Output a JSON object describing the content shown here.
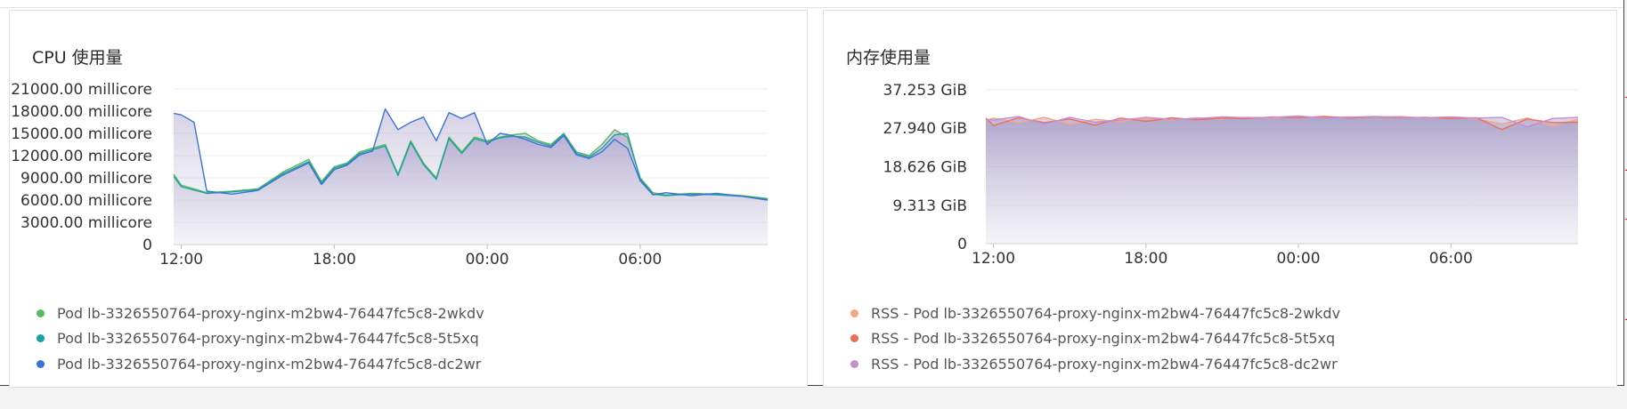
{
  "panels": {
    "cpu": {
      "title": "CPU 使用量"
    },
    "memory": {
      "title": "内存使用量"
    }
  },
  "chart_data": [
    {
      "type": "area",
      "title": "CPU 使用量",
      "ylabel": "",
      "xlabel": "",
      "y_unit": "millicore",
      "ylim": [
        0,
        21000
      ],
      "y_ticks": [
        0,
        3000,
        6000,
        9000,
        12000,
        15000,
        18000,
        21000
      ],
      "y_tick_labels": [
        "0",
        "3000.00 millicore",
        "6000.00 millicore",
        "9000.00 millicore",
        "12000.00 millicore",
        "15000.00 millicore",
        "18000.00 millicore",
        "21000.00 millicore"
      ],
      "x_unit": "hours since 12:00",
      "xlim": [
        -0.3,
        23.0
      ],
      "x_ticks": [
        0,
        6,
        12,
        18
      ],
      "x_tick_labels": [
        "12:00",
        "18:00",
        "00:00",
        "06:00"
      ],
      "grid": true,
      "legend_position": "bottom-left",
      "series": [
        {
          "name": "Pod lb-3326550764-proxy-nginx-m2bw4-76447fc5c8-2wkdv",
          "color": "#5cb85c",
          "x": [
            -0.3,
            0,
            1,
            2,
            3,
            4,
            5,
            5.5,
            6,
            6.5,
            7,
            7.5,
            8,
            8.5,
            9,
            9.5,
            10,
            10.5,
            11,
            11.5,
            12,
            12.5,
            13,
            13.5,
            14,
            14.5,
            15,
            15.5,
            16,
            16.5,
            17,
            17.5,
            18,
            18.5,
            19,
            20,
            21,
            22,
            23
          ],
          "y": [
            9500,
            8000,
            7000,
            7200,
            7500,
            9800,
            11500,
            8500,
            10500,
            11000,
            12500,
            13000,
            13500,
            9500,
            14000,
            11000,
            9000,
            14500,
            12500,
            14500,
            14000,
            14500,
            14800,
            15000,
            14000,
            13500,
            15000,
            12500,
            12000,
            13500,
            15500,
            14500,
            9000,
            7000,
            6700,
            6900,
            6800,
            6600,
            6200
          ]
        },
        {
          "name": "Pod lb-3326550764-proxy-nginx-m2bw4-76447fc5c8-5t5xq",
          "color": "#1aa3a3",
          "x": [
            -0.3,
            0,
            1,
            2,
            3,
            4,
            5,
            5.5,
            6,
            6.5,
            7,
            7.5,
            8,
            8.5,
            9,
            9.5,
            10,
            10.5,
            11,
            11.5,
            12,
            12.5,
            13,
            13.5,
            14,
            14.5,
            15,
            15.5,
            16,
            16.5,
            17,
            17.5,
            18,
            18.5,
            19,
            20,
            21,
            22,
            23
          ],
          "y": [
            9200,
            7800,
            6900,
            7100,
            7400,
            9600,
            11200,
            8300,
            10300,
            10900,
            12300,
            12800,
            13300,
            9300,
            13800,
            10800,
            8800,
            14300,
            12300,
            14300,
            13800,
            14400,
            14600,
            14500,
            13800,
            13300,
            14900,
            12300,
            11800,
            13000,
            14800,
            15000,
            8800,
            6800,
            6600,
            6800,
            6700,
            6500,
            6100
          ]
        },
        {
          "name": "Pod lb-3326550764-proxy-nginx-m2bw4-76447fc5c8-dc2wr",
          "color": "#3b73d6",
          "x": [
            -0.3,
            0,
            0.5,
            1,
            2,
            3,
            4,
            5,
            5.5,
            6,
            6.5,
            7,
            7.5,
            8,
            8.5,
            9,
            9.5,
            10,
            10.5,
            11,
            11.5,
            12,
            12.5,
            13,
            13.5,
            14,
            14.5,
            15,
            15.5,
            16,
            16.5,
            17,
            17.5,
            18,
            18.5,
            19,
            20,
            21,
            22,
            23
          ],
          "y": [
            17700,
            17500,
            16500,
            7200,
            6800,
            7300,
            9400,
            11000,
            8100,
            10100,
            10700,
            12100,
            12600,
            18300,
            15500,
            16500,
            17200,
            14000,
            17800,
            17000,
            17800,
            13500,
            15000,
            14700,
            14200,
            13500,
            13100,
            14700,
            12100,
            11600,
            12500,
            14200,
            13000,
            8600,
            6700,
            7000,
            6600,
            6900,
            6500,
            6000
          ]
        }
      ]
    },
    {
      "type": "area",
      "title": "内存使用量",
      "ylabel": "",
      "xlabel": "",
      "y_unit": "GiB",
      "ylim": [
        0,
        37.253
      ],
      "y_ticks": [
        0,
        9.313,
        18.626,
        27.94,
        37.253
      ],
      "y_tick_labels": [
        "0",
        "9.313 GiB",
        "18.626 GiB",
        "27.940 GiB",
        "37.253 GiB"
      ],
      "x_unit": "hours since 12:00",
      "xlim": [
        -0.3,
        23.0
      ],
      "x_ticks": [
        0,
        6,
        12,
        18
      ],
      "x_tick_labels": [
        "12:00",
        "18:00",
        "00:00",
        "06:00"
      ],
      "grid": true,
      "legend_position": "bottom-left",
      "series": [
        {
          "name": "RSS - Pod lb-3326550764-proxy-nginx-m2bw4-76447fc5c8-2wkdv",
          "color": "#f4a582",
          "x": [
            -0.3,
            0,
            1,
            2,
            3,
            4,
            5,
            6,
            7,
            8,
            9,
            10,
            11,
            12,
            13,
            14,
            15,
            16,
            17,
            18,
            19,
            20,
            21,
            22,
            23
          ],
          "y": [
            29.8,
            30.4,
            29.2,
            30.6,
            28.9,
            30.1,
            29.5,
            30.3,
            29.9,
            30.5,
            30.2,
            30.6,
            30.4,
            30.8,
            30.5,
            30.7,
            30.6,
            30.8,
            30.4,
            30.6,
            30.2,
            29.0,
            30.4,
            28.5,
            30.1
          ]
        },
        {
          "name": "RSS - Pod lb-3326550764-proxy-nginx-m2bw4-76447fc5c8-5t5xq",
          "color": "#e8705a",
          "x": [
            -0.3,
            0,
            1,
            2,
            3,
            4,
            5,
            6,
            7,
            8,
            9,
            10,
            11,
            12,
            13,
            14,
            15,
            16,
            17,
            18,
            19,
            20,
            21,
            22,
            23
          ],
          "y": [
            30.4,
            28.6,
            30.5,
            29.3,
            30.2,
            28.7,
            30.4,
            29.6,
            30.5,
            30.0,
            30.4,
            30.3,
            30.7,
            30.5,
            30.8,
            30.4,
            30.7,
            30.5,
            30.6,
            30.3,
            30.5,
            27.6,
            30.2,
            29.3,
            29.4
          ]
        },
        {
          "name": "RSS - Pod lb-3326550764-proxy-nginx-m2bw4-76447fc5c8-dc2wr",
          "color": "#c28fd6",
          "x": [
            -0.3,
            0,
            1,
            2,
            3,
            4,
            5,
            6,
            7,
            8,
            9,
            10,
            11,
            12,
            13,
            14,
            15,
            16,
            17,
            18,
            19,
            20,
            21,
            22,
            23
          ],
          "y": [
            30.1,
            29.9,
            30.8,
            28.9,
            30.6,
            29.4,
            29.9,
            30.6,
            30.1,
            30.3,
            30.7,
            30.5,
            30.6,
            30.9,
            30.4,
            30.6,
            30.8,
            30.6,
            30.5,
            30.7,
            30.4,
            30.6,
            28.3,
            30.3,
            30.6
          ]
        }
      ]
    }
  ]
}
